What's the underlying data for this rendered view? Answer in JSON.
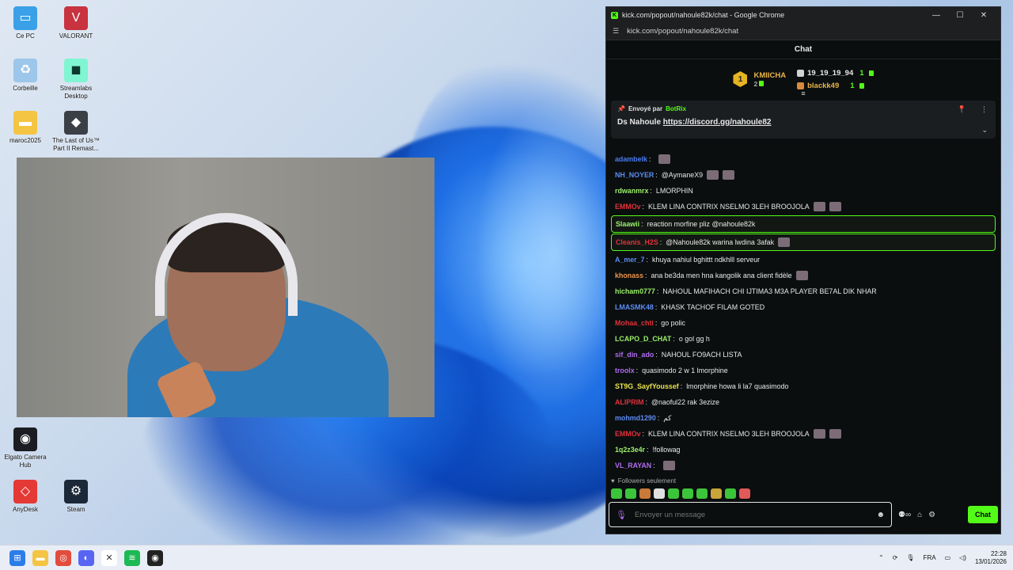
{
  "desktop": {
    "icons": [
      {
        "label": "Ce PC"
      },
      {
        "label": "VALORANT"
      },
      {
        "label": "Corbeille"
      },
      {
        "label": "Streamlabs Desktop"
      },
      {
        "label": "maroc2025"
      },
      {
        "label": "The Last of Us™ Part II Remast..."
      },
      {
        "label": "Elgato Camera Hub"
      },
      {
        "label": "AnyDesk"
      },
      {
        "label": "Steam"
      }
    ]
  },
  "browser": {
    "window_title": "kick.com/popout/nahoule82k/chat - Google Chrome",
    "url": "kick.com/popout/nahoule82k/chat",
    "minimize": "—",
    "maximize": "☐",
    "close": "✕"
  },
  "chat": {
    "header": "Chat",
    "leaderboard": {
      "first": {
        "rank": "1",
        "name": "KMIICHA",
        "count": "2"
      },
      "second": {
        "name": "19_19_19_94",
        "count": "1"
      },
      "third": {
        "name": "blackk49",
        "count": "1"
      }
    },
    "pinned": {
      "sent_by_label": "Envoyé par",
      "sender": "BotRix",
      "message_prefix": "Ds Nahoule",
      "link": "https://discord.gg/nahoule82"
    },
    "messages": [
      {
        "user": "adambelk",
        "color": "#4a7bf0",
        "text": "",
        "emotes": 1,
        "highlight": false
      },
      {
        "user": "NH_NOYER",
        "color": "#5b8cf2",
        "text": "@AymaneX9",
        "emotes": 2,
        "highlight": false
      },
      {
        "user": "rdwanmrx",
        "color": "#9bf06b",
        "text": "LMORPHIN",
        "emotes": 0,
        "highlight": false
      },
      {
        "user": "EMMOv",
        "color": "#e0323a",
        "text": "KLEM LINA CONTRIX NSELMO 3LEH BROOJOLA",
        "emotes": 2,
        "highlight": false
      },
      {
        "user": "Slaawii",
        "color": "#9bf06b",
        "text": "reaction morfine pliz @nahoule82k",
        "emotes": 0,
        "highlight": true
      },
      {
        "user": "Cleanis_H2S",
        "color": "#e0323a",
        "text": "@Nahoule82k warina lwdina 3afak",
        "emotes": 1,
        "highlight": true
      },
      {
        "user": "A_mer_7",
        "color": "#5b8cf2",
        "text": "khuya nahiul bghittt ndkhlll serveur",
        "emotes": 0,
        "highlight": false
      },
      {
        "user": "khonass",
        "color": "#f0954a",
        "text": "ana be3da men hna kangolik ana client fidèle",
        "emotes": 1,
        "highlight": false
      },
      {
        "user": "hicham0777",
        "color": "#9bf06b",
        "text": "NAHOUL MAFIHACH CHI IJTIMA3 M3A PLAYER BE7AL DIK NHAR",
        "emotes": 0,
        "highlight": false
      },
      {
        "user": "LMASMK48",
        "color": "#5b8cf2",
        "text": "KHASK TACHOF FILAM GOTED",
        "emotes": 0,
        "highlight": false
      },
      {
        "user": "Mohaa_chti",
        "color": "#e0323a",
        "text": "go polic",
        "emotes": 0,
        "highlight": false
      },
      {
        "user": "LCAPO_D_CHAT",
        "color": "#9bf06b",
        "text": "o gol gg h",
        "emotes": 0,
        "highlight": false
      },
      {
        "user": "sif_din_ado",
        "color": "#b06cf0",
        "text": "NAHOUL FO9ACH LISTA",
        "emotes": 0,
        "highlight": false
      },
      {
        "user": "troolx",
        "color": "#b06cf0",
        "text": "quasimodo 2 w 1 lmorphine",
        "emotes": 0,
        "highlight": false
      },
      {
        "user": "ST9G_SayfYoussef",
        "color": "#e8e34a",
        "text": "lmorphine howa li la7 quasimodo",
        "emotes": 0,
        "highlight": false
      },
      {
        "user": "ALIPRIM",
        "color": "#e0323a",
        "text": "@naoful22 rak 3ezize",
        "emotes": 0,
        "highlight": false
      },
      {
        "user": "mohmd1290",
        "color": "#5b8cf2",
        "text": "کم",
        "emotes": 0,
        "highlight": false
      },
      {
        "user": "EMMOv",
        "color": "#e0323a",
        "text": "KLEM LINA CONTRIX NSELMO 3LEH BROOJOLA",
        "emotes": 2,
        "highlight": false
      },
      {
        "user": "1q2z3e4r",
        "color": "#9bf06b",
        "text": "!followag",
        "emotes": 0,
        "highlight": false
      },
      {
        "user": "VL_RAYAN",
        "color": "#b06cf0",
        "text": "",
        "emotes": 1,
        "highlight": false
      }
    ],
    "followers_only": "Followers seulement",
    "input_placeholder": "Envoyer un message",
    "send_label": "Chat"
  },
  "taskbar": {
    "lang": "FRA",
    "time": "22:28",
    "date": "13/01/2026"
  },
  "colors": {
    "kick_green": "#53fc18",
    "chat_bg": "#0b0e0f"
  }
}
